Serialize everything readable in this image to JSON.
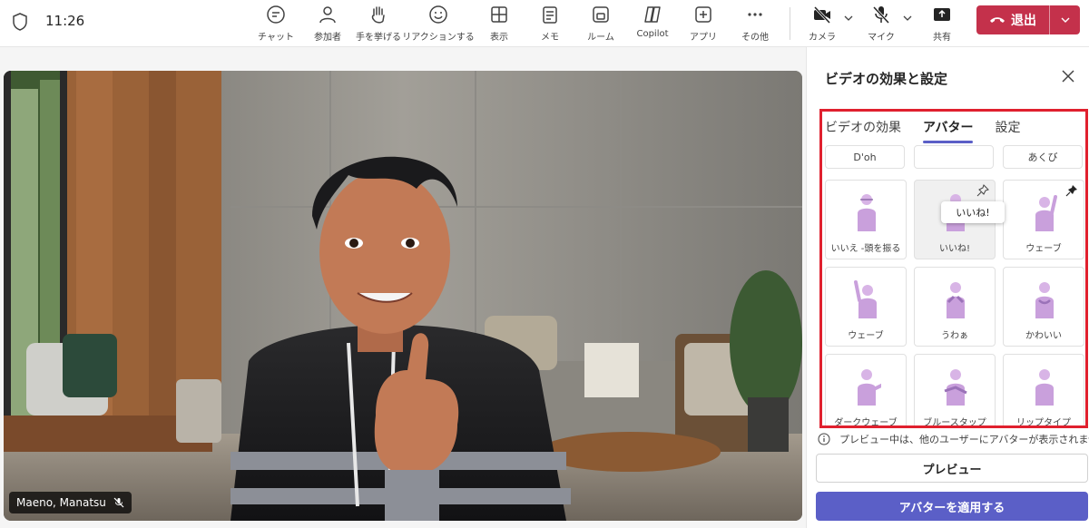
{
  "topbar": {
    "time": "11:26",
    "tools": [
      {
        "label": "チャット",
        "icon": "chat-icon"
      },
      {
        "label": "参加者",
        "icon": "people-icon"
      },
      {
        "label": "手を挙げる",
        "icon": "raise-hand-icon"
      },
      {
        "label": "リアクションする",
        "icon": "smile-icon"
      },
      {
        "label": "表示",
        "icon": "grid-view-icon"
      },
      {
        "label": "メモ",
        "icon": "notes-icon"
      },
      {
        "label": "ルーム",
        "icon": "rooms-icon"
      },
      {
        "label": "Copilot",
        "icon": "copilot-icon"
      },
      {
        "label": "アプリ",
        "icon": "add-apps-icon"
      },
      {
        "label": "その他",
        "icon": "more-icon"
      },
      {
        "label": "カメラ",
        "icon": "camera-off-icon"
      },
      {
        "label": "マイク",
        "icon": "mic-off-icon"
      },
      {
        "label": "共有",
        "icon": "share-icon"
      }
    ],
    "leave_label": "退出"
  },
  "video": {
    "participant_name": "Maeno, Manatsu"
  },
  "panel": {
    "title": "ビデオの効果と設定",
    "tabs": [
      "ビデオの効果",
      "アバター",
      "設定"
    ],
    "active_tab": "アバター",
    "short_buttons": [
      "D'oh",
      "",
      "あくび"
    ],
    "tooltip": "いいね!",
    "tiles": [
      {
        "label": "いいえ -頭を振る",
        "pinned": false
      },
      {
        "label": "いいね!",
        "pinned": false,
        "pin_outline": true
      },
      {
        "label": "ウェーブ",
        "pinned": true
      },
      {
        "label": "ウェーブ",
        "pinned": false
      },
      {
        "label": "うわぁ",
        "pinned": false
      },
      {
        "label": "かわいい",
        "pinned": false
      },
      {
        "label": "ダークウェーブ",
        "pinned": false
      },
      {
        "label": "ブルースタップ",
        "pinned": false
      },
      {
        "label": "リップタイプ",
        "pinned": false
      }
    ],
    "preview_note": "プレビュー中は、他のユーザーにアバターが表示されません。",
    "preview_button": "プレビュー",
    "apply_button": "アバターを適用する"
  },
  "colors": {
    "accent": "#5b5fc7",
    "leave": "#c4314b",
    "highlight": "#e0202e"
  }
}
